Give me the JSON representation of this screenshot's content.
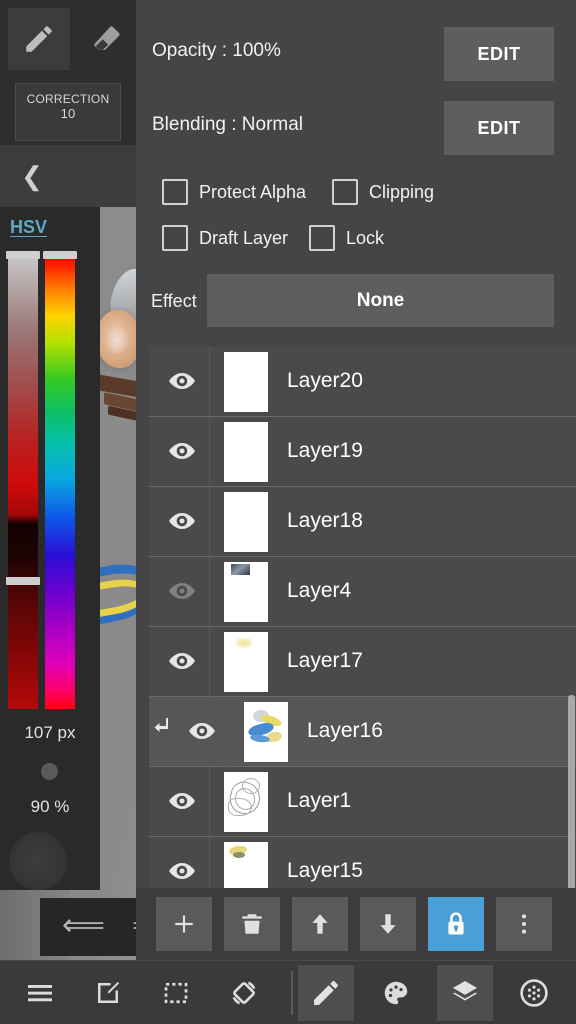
{
  "app": {
    "name": "paint-app",
    "accent_color": "#4a9fd8",
    "panel_bg": "#454545",
    "link_color": "#5ea9c4"
  },
  "left_tools": {
    "pen_icon": "pencil-icon",
    "eraser_icon": "eraser-icon",
    "correction_label": "CORRECTION",
    "correction_value": "10",
    "back_icon": "chevron-left-icon"
  },
  "color_panel": {
    "mode_label": "HSV",
    "sv_bar_name": "saturation-value-bar",
    "hue_bar_name": "hue-bar",
    "brush_size": "107 px",
    "brush_opacity": "90 %",
    "preview_name": "brush-preview"
  },
  "history": {
    "undo_icon": "undo-arrow-icon",
    "redo_icon": "redo-arrow-icon"
  },
  "layer_properties": {
    "opacity_label": "Opacity : 100%",
    "opacity_edit": "EDIT",
    "blending_label": "Blending : Normal",
    "blending_edit": "EDIT",
    "checkboxes": [
      {
        "label": "Protect Alpha",
        "checked": false
      },
      {
        "label": "Clipping",
        "checked": false
      },
      {
        "label": "Draft Layer",
        "checked": false
      },
      {
        "label": "Lock",
        "checked": false
      }
    ],
    "effect_label": "Effect",
    "effect_value": "None"
  },
  "layers": [
    {
      "name": "Layer20",
      "visible": true,
      "clipped": false,
      "selected": false,
      "thumb": "blank"
    },
    {
      "name": "Layer19",
      "visible": true,
      "clipped": false,
      "selected": false,
      "thumb": "blank"
    },
    {
      "name": "Layer18",
      "visible": true,
      "clipped": false,
      "selected": false,
      "thumb": "blank"
    },
    {
      "name": "Layer4",
      "visible": false,
      "clipped": false,
      "selected": false,
      "thumb": "smallimg"
    },
    {
      "name": "Layer17",
      "visible": true,
      "clipped": false,
      "selected": false,
      "thumb": "yellowsmudge"
    },
    {
      "name": "Layer16",
      "visible": true,
      "clipped": true,
      "selected": true,
      "thumb": "colorart"
    },
    {
      "name": "Layer1",
      "visible": true,
      "clipped": false,
      "selected": false,
      "thumb": "sketch"
    },
    {
      "name": "Layer15",
      "visible": true,
      "clipped": false,
      "selected": false,
      "thumb": "yellowsketch"
    }
  ],
  "layer_toolbar": [
    {
      "name": "add-layer-button",
      "icon": "plus-icon",
      "active": false
    },
    {
      "name": "delete-layer-button",
      "icon": "trash-icon",
      "active": false
    },
    {
      "name": "move-up-button",
      "icon": "arrow-up-icon",
      "active": false
    },
    {
      "name": "move-down-button",
      "icon": "arrow-down-icon",
      "active": false
    },
    {
      "name": "lock-layer-button",
      "icon": "lock-icon",
      "active": true
    },
    {
      "name": "more-options-button",
      "icon": "dots-vertical-icon",
      "active": false
    }
  ],
  "bottom_nav": [
    {
      "name": "menu-button",
      "icon": "hamburger-menu-icon",
      "active": false
    },
    {
      "name": "canvas-edit-button",
      "icon": "edit-square-icon",
      "active": false
    },
    {
      "name": "selection-button",
      "icon": "marquee-select-icon",
      "active": false
    },
    {
      "name": "rotate-canvas-button",
      "icon": "rotate-icon",
      "active": false
    },
    {
      "name": "draw-tool-button",
      "icon": "pencil-icon",
      "active": true
    },
    {
      "name": "palette-button",
      "icon": "palette-icon",
      "active": false
    },
    {
      "name": "layers-button",
      "icon": "layers-icon",
      "active": true
    },
    {
      "name": "brush-settings-button",
      "icon": "brush-dots-icon",
      "active": false
    }
  ]
}
